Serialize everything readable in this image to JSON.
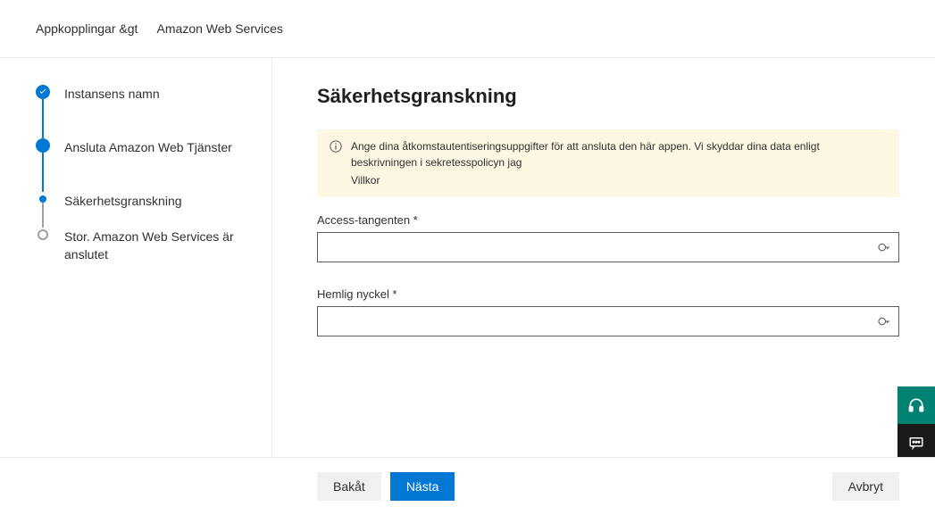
{
  "breadcrumb": {
    "item1": "Appkopplingar &gt",
    "item2": "Amazon Web Services"
  },
  "steps": [
    {
      "label": "Instansens namn"
    },
    {
      "label": "Ansluta Amazon Web Tjänster"
    },
    {
      "label": "Säkerhetsgranskning"
    },
    {
      "label": "Stor. Amazon Web Services är anslutet"
    }
  ],
  "main": {
    "title": "Säkerhetsgranskning",
    "banner": {
      "text": "Ange dina åtkomstautentiseringsuppgifter för att ansluta den här appen. Vi skyddar dina data enligt beskrivningen i sekretesspolicyn jag",
      "link": "Villkor"
    },
    "fields": {
      "accessKey": {
        "label": "Access-tangenten *",
        "value": ""
      },
      "secretKey": {
        "label": "Hemlig nyckel *",
        "value": ""
      }
    }
  },
  "footer": {
    "back": "Bakåt",
    "next": "Nästa",
    "cancel": "Avbryt"
  }
}
